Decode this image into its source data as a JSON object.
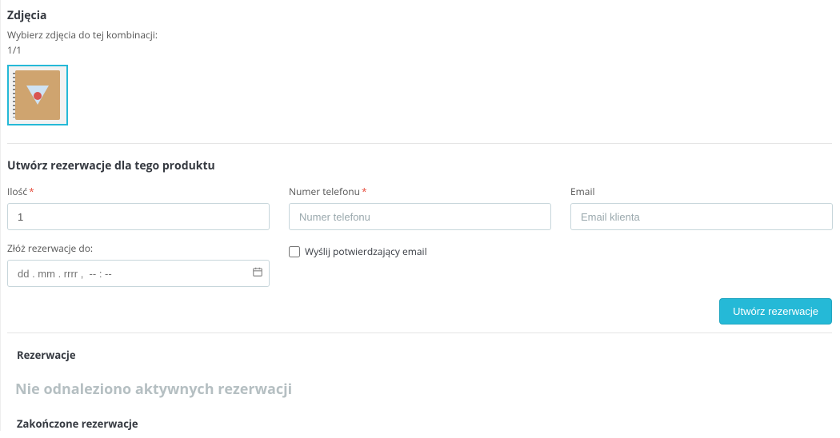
{
  "photos": {
    "title": "Zdjęcia",
    "hint": "Wybierz zdjęcia do tej kombinacji:",
    "counter": "1/1"
  },
  "form": {
    "title": "Utwórz rezerwacje dla tego produktu",
    "qty_label": "Ilość",
    "qty_value": "1",
    "phone_label": "Numer telefonu",
    "phone_placeholder": "Numer telefonu",
    "email_label": "Email",
    "email_placeholder": "Email klienta",
    "until_label": "Złóż rezerwacje do:",
    "date_placeholder": "dd . mm . rrrr ,  -- : --",
    "confirm_label": "Wyślij potwierdzający email",
    "submit": "Utwórz rezerwacje"
  },
  "reservations": {
    "title": "Rezerwacje",
    "empty": "Nie odnaleziono aktywnych rezerwacji",
    "closed_title": "Zakończone rezerwacje"
  }
}
